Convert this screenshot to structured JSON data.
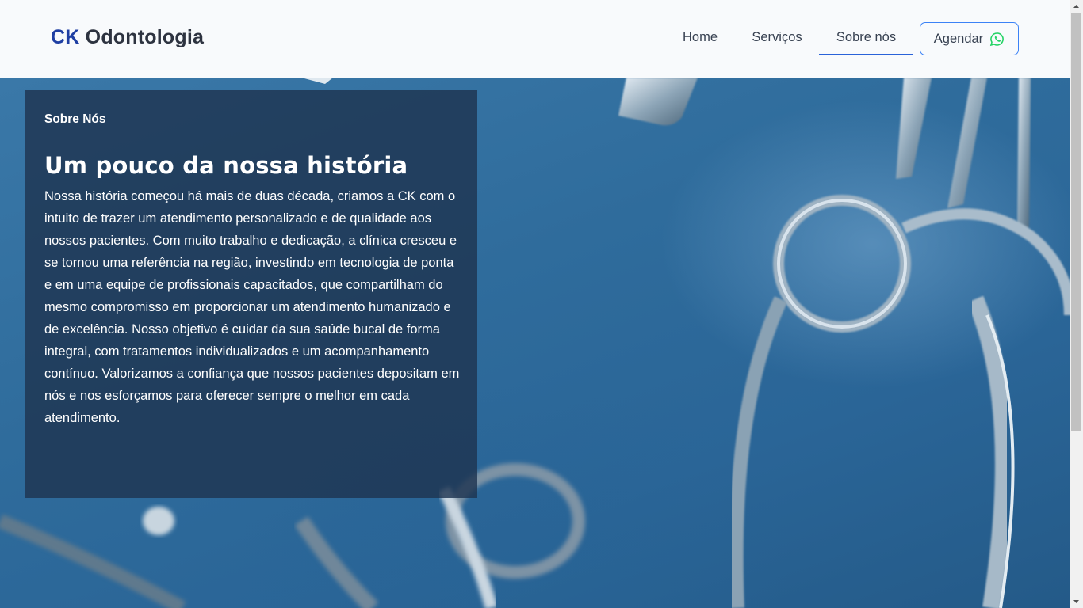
{
  "header": {
    "logo_ck": "CK",
    "logo_rest": "Odontologia",
    "nav": {
      "home": "Home",
      "servicos": "Serviços",
      "sobre": "Sobre nós"
    },
    "cta_label": "Agendar",
    "cta_icon": "whatsapp-icon",
    "accent_color": "#2a63d9",
    "cta_icon_color": "#25d366"
  },
  "about": {
    "kicker": "Sobre Nós",
    "title": "Um pouco da nossa história",
    "body": "Nossa história começou há mais de duas década, criamos a CK com o intuito de trazer um atendimento personalizado e de qualidade aos nossos pacientes. Com muito trabalho e dedicação, a clínica cresceu e se tornou uma referência na região, investindo em tecnologia de ponta e em uma equipe de profissionais capacitados, que compartilham do mesmo compromisso em proporcionar um atendimento humanizado e de excelência. Nosso objetivo é cuidar da sua saúde bucal de forma integral, com tratamentos individualizados e um acompanhamento contínuo. Valorizamos a confiança que nossos pacientes depositam em nós e nos esforçamos para oferecer sempre o melhor em cada atendimento."
  }
}
